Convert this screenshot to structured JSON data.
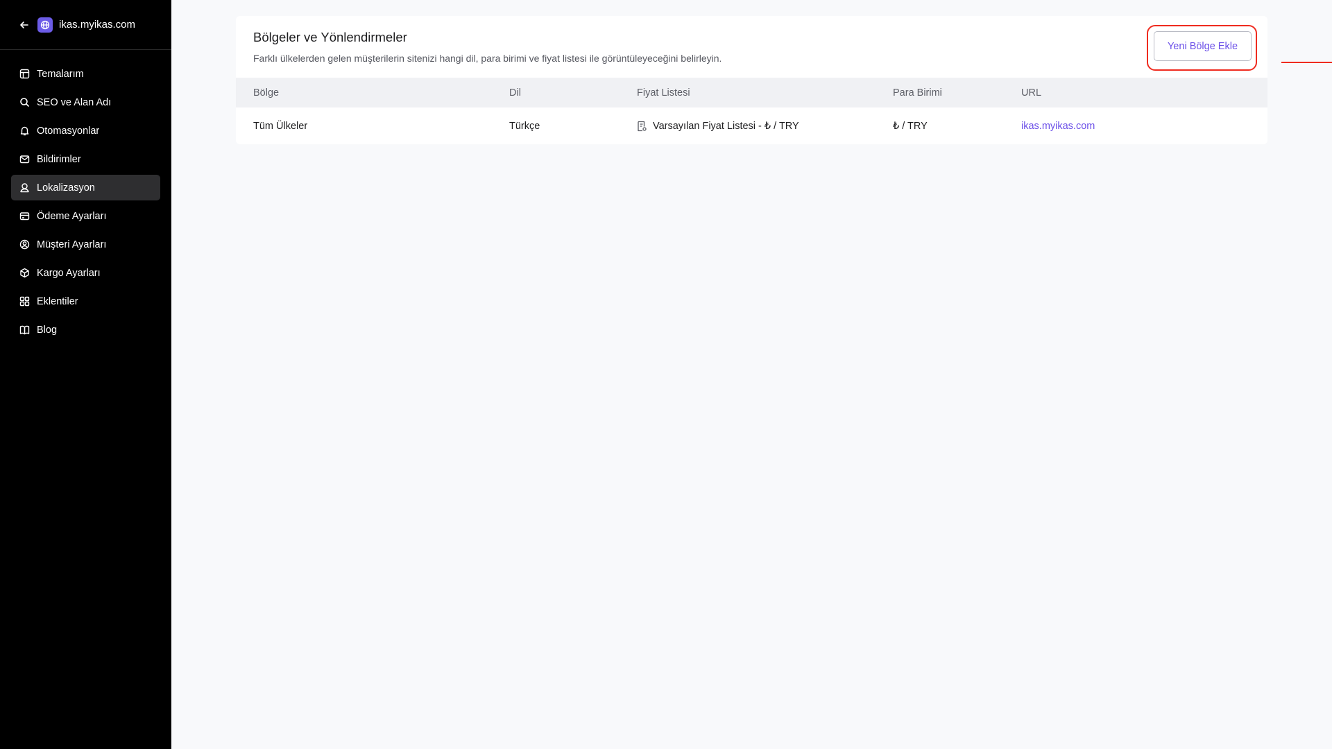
{
  "sidebar": {
    "site_name": "ikas.myikas.com",
    "items": [
      {
        "label": "Temalarım",
        "icon": "layout-icon",
        "active": false
      },
      {
        "label": "SEO ve Alan Adı",
        "icon": "search-icon",
        "active": false
      },
      {
        "label": "Otomasyonlar",
        "icon": "bell-icon",
        "active": false
      },
      {
        "label": "Bildirimler",
        "icon": "mail-icon",
        "active": false
      },
      {
        "label": "Lokalizasyon",
        "icon": "location-user-icon",
        "active": true
      },
      {
        "label": "Ödeme Ayarları",
        "icon": "credit-card-icon",
        "active": false
      },
      {
        "label": "Müşteri Ayarları",
        "icon": "user-circle-icon",
        "active": false
      },
      {
        "label": "Kargo Ayarları",
        "icon": "package-icon",
        "active": false
      },
      {
        "label": "Eklentiler",
        "icon": "grid-icon",
        "active": false
      },
      {
        "label": "Blog",
        "icon": "book-icon",
        "active": false
      }
    ]
  },
  "main": {
    "title": "Bölgeler ve Yönlendirmeler",
    "description": "Farklı ülkelerden gelen müşterilerin sitenizi hangi dil, para birimi ve fiyat listesi ile görüntüleyeceğini belirleyin.",
    "add_button_label": "Yeni Bölge Ekle",
    "columns": [
      "Bölge",
      "Dil",
      "Fiyat Listesi",
      "Para Birimi",
      "URL"
    ],
    "rows": [
      [
        "Tüm Ülkeler",
        "Türkçe",
        "Varsayılan Fiyat Listesi - ₺ / TRY",
        "₺ / TRY",
        "ikas.myikas.com"
      ]
    ]
  },
  "colors": {
    "sidebar_bg": "#000000",
    "active_item_bg": "#2e2e30",
    "accent": "#6b4fe8",
    "annotation": "#ef2b1f"
  }
}
